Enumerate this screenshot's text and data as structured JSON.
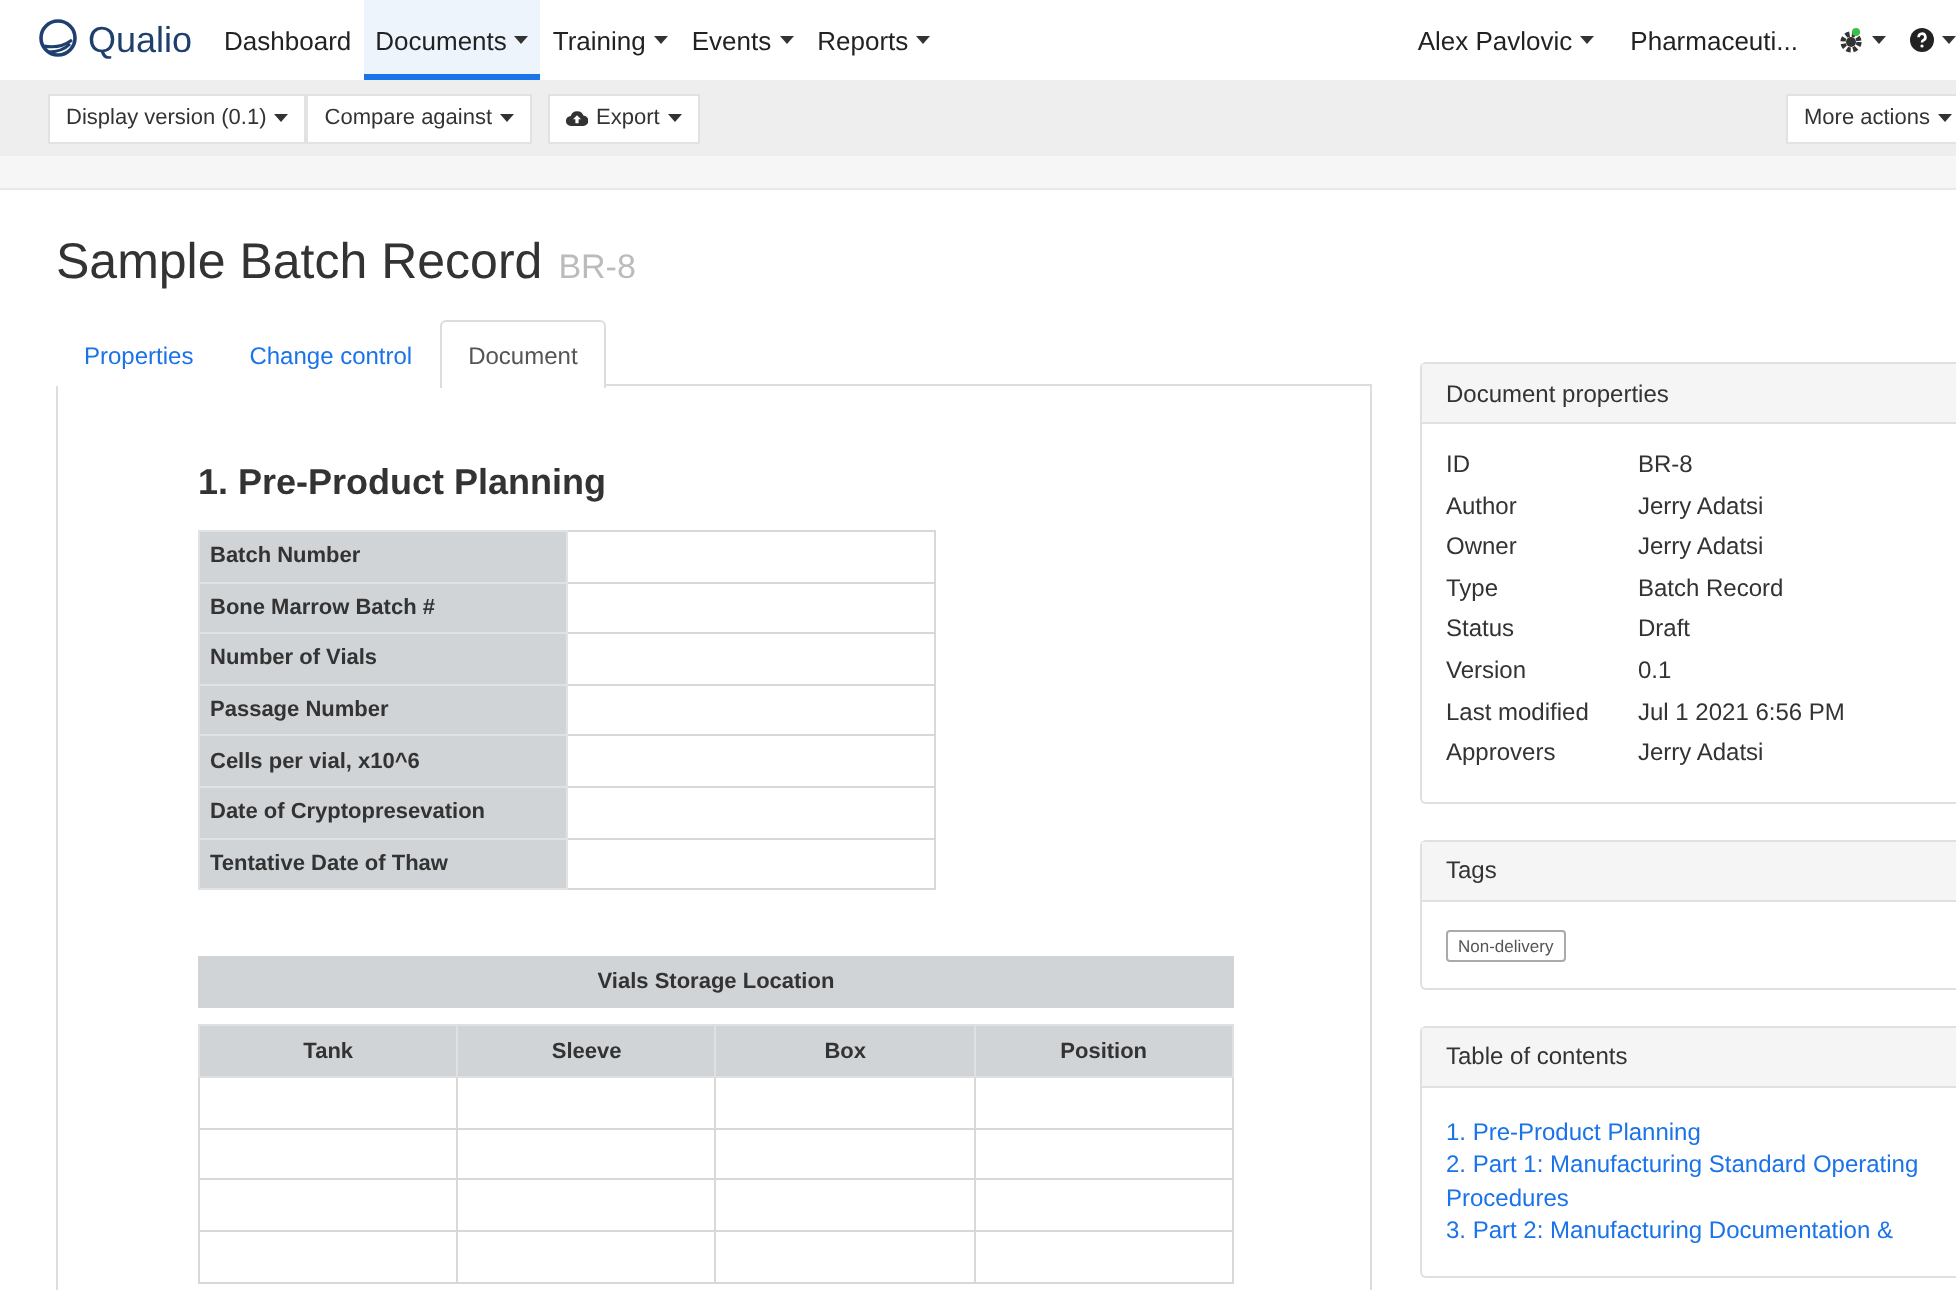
{
  "nav": {
    "brand": "Qualio",
    "items": [
      {
        "label": "Dashboard",
        "has_menu": false,
        "selected": false
      },
      {
        "label": "Documents",
        "has_menu": true,
        "selected": true
      },
      {
        "label": "Training",
        "has_menu": true,
        "selected": false
      },
      {
        "label": "Events",
        "has_menu": true,
        "selected": false
      },
      {
        "label": "Reports",
        "has_menu": true,
        "selected": false
      }
    ],
    "user": "Alex Pavlovic",
    "company": "Pharmaceuti..."
  },
  "toolbar": {
    "left": [
      "Display version (0.1)",
      "Compare against",
      "Export"
    ],
    "right": "More actions"
  },
  "title": "Sample Batch Record",
  "doc_id": "BR-8",
  "tabs": [
    {
      "label": "Properties",
      "selected": false
    },
    {
      "label": "Change control",
      "selected": false
    },
    {
      "label": "Document",
      "selected": true
    }
  ],
  "document": {
    "heading": "1. Pre-Product Planning",
    "fields": [
      "Batch Number",
      "Bone Marrow Batch #",
      "Number of Vials",
      "Passage Number",
      "Cells per vial, x10^6",
      "Date of Cryptopresevation",
      "Tentative Date of Thaw"
    ],
    "storage": {
      "title": "Vials Storage Location",
      "columns": [
        "Tank",
        "Sleeve",
        "Box",
        "Position"
      ]
    }
  },
  "properties": {
    "title": "Document properties",
    "rows": [
      {
        "label": "ID",
        "value": "BR-8"
      },
      {
        "label": "Author",
        "value": "Jerry Adatsi"
      },
      {
        "label": "Owner",
        "value": "Jerry Adatsi"
      },
      {
        "label": "Type",
        "value": "Batch Record"
      },
      {
        "label": "Status",
        "value": "Draft"
      },
      {
        "label": "Version",
        "value": "0.1"
      },
      {
        "label": "Last modified",
        "value": "Jul 1 2021 6:56 PM"
      },
      {
        "label": "Approvers",
        "value": "Jerry Adatsi"
      }
    ]
  },
  "tags": {
    "title": "Tags",
    "items": [
      "Non-delivery"
    ]
  },
  "toc": {
    "title": "Table of contents",
    "items": [
      "1. Pre-Product Planning",
      "2. Part 1: Manufacturing Standard Operating Procedures",
      "3. Part 2: Manufacturing Documentation &"
    ]
  }
}
